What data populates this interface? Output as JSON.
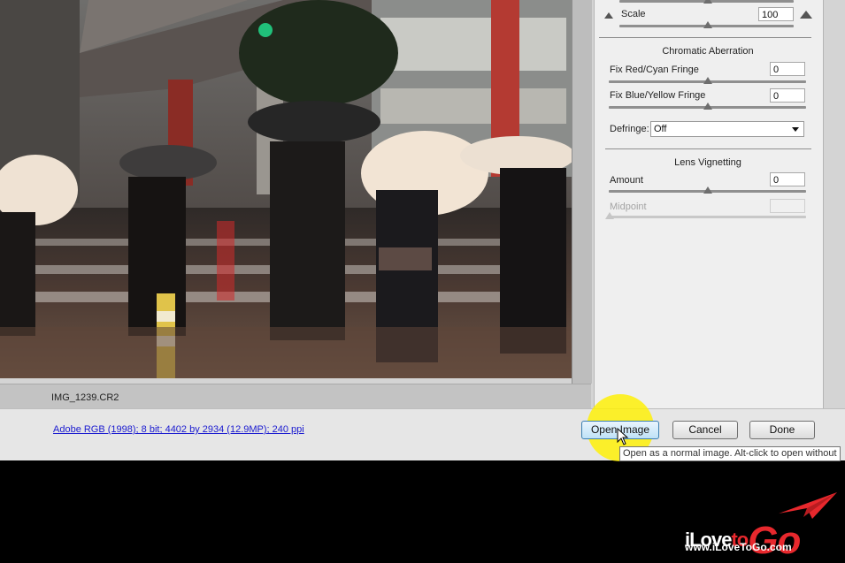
{
  "preview": {
    "filename": "IMG_1239.CR2"
  },
  "panel": {
    "scale": {
      "label": "Scale",
      "value": "100",
      "slider": 0.5
    },
    "chromatic": {
      "title": "Chromatic Aberration",
      "red_cyan": {
        "label": "Fix Red/Cyan Fringe",
        "value": "0",
        "slider": 0.5
      },
      "blue_yellow": {
        "label": "Fix Blue/Yellow Fringe",
        "value": "0",
        "slider": 0.5
      },
      "defringe": {
        "label": "Defringe:",
        "value": "Off"
      }
    },
    "vignetting": {
      "title": "Lens Vignetting",
      "amount": {
        "label": "Amount",
        "value": "0",
        "slider": 0.5
      },
      "midpoint": {
        "label": "Midpoint",
        "value": "",
        "slider": 0.0
      }
    }
  },
  "footer": {
    "info": "Adobe RGB (1998); 8 bit; 4402 by 2934 (12.9MP); 240 ppi",
    "open_image": "Open Image",
    "cancel": "Cancel",
    "done": "Done",
    "tooltip": "Open as a normal image.  Alt-click to open without"
  },
  "icons": {
    "scale_small": "mountain-small-icon",
    "scale_large": "mountain-large-icon",
    "cursor": "pointer-cursor-icon"
  },
  "colors": {
    "accent": "#e7282d",
    "highlight": "#fff000"
  },
  "watermark": {
    "brand": "iLoveToGo",
    "url": "www.iLoveToGo.com"
  }
}
